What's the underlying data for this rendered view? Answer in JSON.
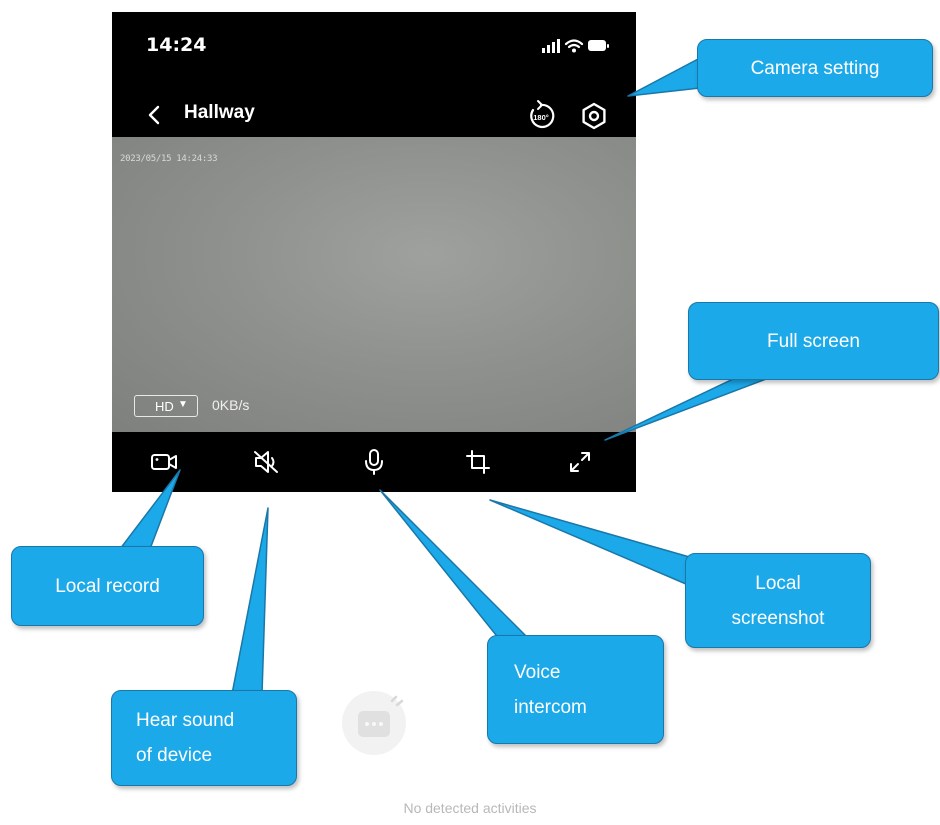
{
  "status_bar": {
    "time": "14:24"
  },
  "header": {
    "title": "Hallway",
    "back_icon": "chevron-left-icon",
    "rotate_icon": "rotate-180-icon",
    "settings_icon": "hexagon-gear-icon"
  },
  "video": {
    "timestamp": "2023/05/15 14:24:33",
    "quality": "HD",
    "bitrate": "0KB/s"
  },
  "toolbar": {
    "icons": [
      "video-record-icon",
      "speaker-mute-icon",
      "microphone-icon",
      "crop-icon",
      "expand-icon"
    ]
  },
  "callouts": {
    "camera_setting": "Camera setting",
    "full_screen": "Full screen",
    "local_record": "Local record",
    "local_screenshot": "Local\nscreenshot",
    "voice_intercom": "Voice\nintercom",
    "hear_sound": "Hear  sound\nof device"
  },
  "empty_state": {
    "text": "No detected activities"
  },
  "colors": {
    "callout_fill": "#1ba9e9",
    "callout_border": "#1a77a8",
    "phone_bg": "#000000",
    "video_bg": "#8f918e"
  }
}
